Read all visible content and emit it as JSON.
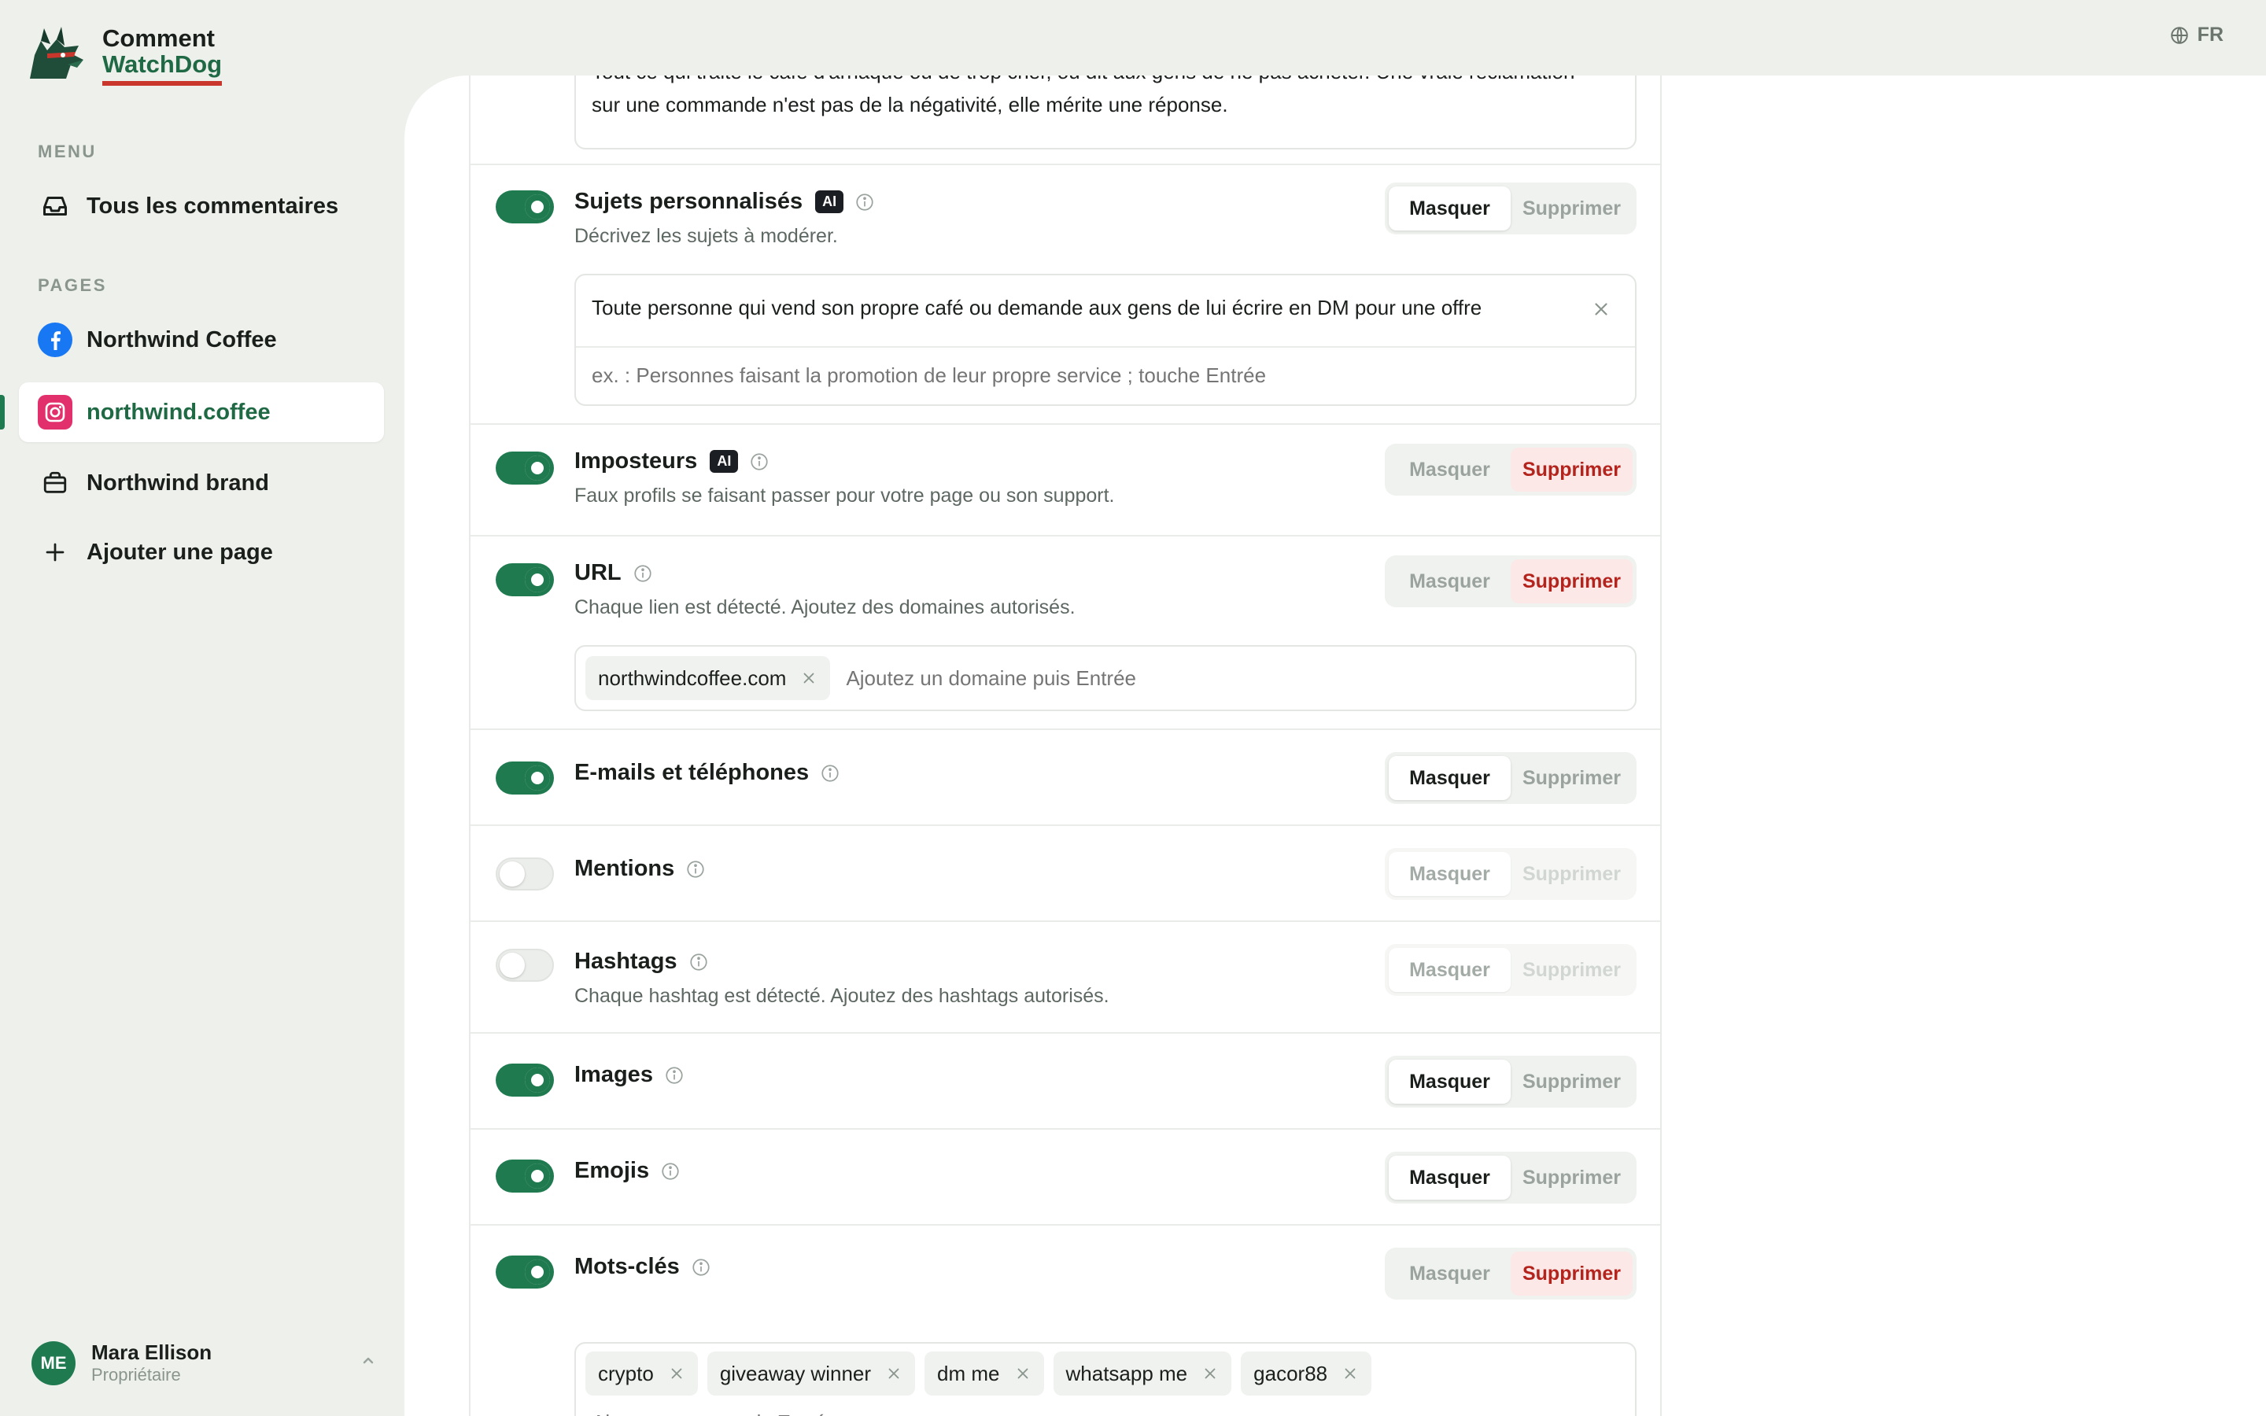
{
  "brand": {
    "line1": "Comment",
    "line2": "WatchDog"
  },
  "lang": {
    "code": "FR"
  },
  "sidebar": {
    "menu_label": "MENU",
    "all_comments": "Tous les commentaires",
    "pages_label": "PAGES",
    "pages": [
      {
        "label": "Northwind Coffee",
        "icon": "facebook-icon"
      },
      {
        "label": "northwind.coffee",
        "icon": "instagram-icon",
        "active": true
      },
      {
        "label": "Northwind brand",
        "icon": "briefcase-icon"
      }
    ],
    "add_page": "Ajouter une page"
  },
  "user": {
    "initials": "ME",
    "name": "Mara Ellison",
    "role": "Propriétaire"
  },
  "colors": {
    "accent": "#1f7a4f",
    "danger": "#b4231c",
    "logo_underline": "#c9372c"
  },
  "rules": {
    "top_text": {
      "line1": "Tout ce qui traite le café d'arnaque ou de trop cher, ou dit aux gens de ne pas acheter. Une vraie réclamation",
      "line2": "sur une commande n'est pas de la négativité, elle mérite une réponse."
    },
    "custom": {
      "title": "Sujets personnalisés",
      "ai": "AI",
      "desc": "Décrivez les sujets à modérer.",
      "entry": "Toute personne qui vend son propre café ou demande aux gens de lui écrire en DM pour une offre",
      "placeholder": "ex. : Personnes faisant la promotion de leur propre service ; touche Entrée",
      "enabled": true,
      "action": "Masquer"
    },
    "impostors": {
      "title": "Imposteurs",
      "ai": "AI",
      "desc": "Faux profils se faisant passer pour votre page ou son support.",
      "enabled": true,
      "action": "Supprimer"
    },
    "url": {
      "title": "URL",
      "desc": "Chaque lien est détecté. Ajoutez des domaines autorisés.",
      "chips": [
        "northwindcoffee.com"
      ],
      "placeholder": "Ajoutez un domaine puis Entrée",
      "enabled": true,
      "action": "Supprimer"
    },
    "emails": {
      "title": "E-mails et téléphones",
      "enabled": true,
      "action": "Masquer"
    },
    "mentions": {
      "title": "Mentions",
      "enabled": false,
      "action": "Masquer"
    },
    "hashtags": {
      "title": "Hashtags",
      "desc": "Chaque hashtag est détecté. Ajoutez des hashtags autorisés.",
      "enabled": false,
      "action": "Masquer"
    },
    "images": {
      "title": "Images",
      "enabled": true,
      "action": "Masquer"
    },
    "emojis": {
      "title": "Emojis",
      "enabled": true,
      "action": "Masquer"
    },
    "keywords": {
      "title": "Mots-clés",
      "chips": [
        "crypto",
        "giveaway winner",
        "dm me",
        "whatsapp me",
        "gacor88"
      ],
      "placeholder": "Ajoutez un mot puis Entrée",
      "enabled": true,
      "action": "Supprimer"
    }
  },
  "actions": {
    "hide": "Masquer",
    "delete": "Supprimer"
  }
}
